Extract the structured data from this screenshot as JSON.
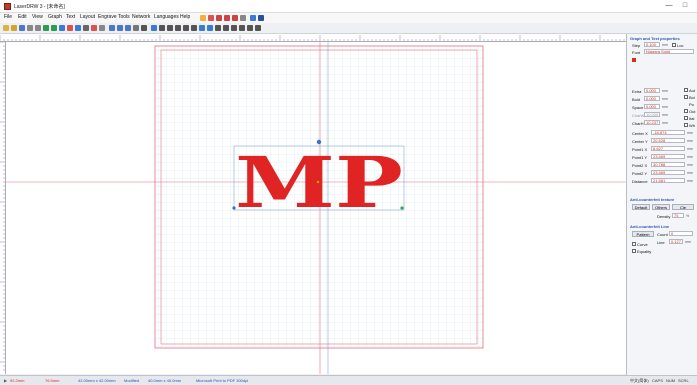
{
  "window": {
    "title": "LaserDRW 3 - [未命名]",
    "min": "—",
    "max": "□"
  },
  "menu": [
    "File",
    "Edit",
    "View",
    "Graph",
    "Text",
    "Layout",
    "Engrave",
    "Tools",
    "Network",
    "Languages",
    "Help"
  ],
  "canvas": {
    "design_text": "MP",
    "text_color": "#e02424"
  },
  "panel": {
    "header": "Graph and Text properties",
    "step_label": "Step",
    "step_value": "0.100",
    "step_unit": "mm",
    "lock_label": "Loc",
    "font_label": "Font",
    "font_value": "Niagara Solid",
    "extra_label": "Extra",
    "extra_value": "0.000",
    "extra_unit": "mm",
    "bold_label": "Bold",
    "bold_value": "0.000",
    "bold_unit": "mm",
    "space_label": "Space",
    "space_value": "0.000",
    "space_unit": "mm",
    "charw_label": "CharW",
    "charw_value": "10.000",
    "charw_unit": "mm",
    "charh_label": "CharH",
    "charh_value": "10.237",
    "charh_unit": "mm",
    "chk1": "Aut",
    "chk2": "Bol",
    "chk3": "Po",
    "chk4": "Out",
    "chk5": "Ital",
    "chk6": "Wh",
    "fields": [
      {
        "label": "Center X",
        "value": "-18.874",
        "unit": "mm"
      },
      {
        "label": "Center Y",
        "value": "20.528",
        "unit": "mm"
      },
      {
        "label": "Point1 X",
        "value": "8.627",
        "unit": "mm"
      },
      {
        "label": "Point1 Y",
        "value": "23.469",
        "unit": "mm"
      },
      {
        "label": "Point2 X",
        "value": "30.788",
        "unit": "mm"
      },
      {
        "label": "Point2 Y",
        "value": "23.469",
        "unit": "mm"
      },
      {
        "label": "Distance",
        "value": "21.581",
        "unit": "mm"
      }
    ],
    "ac_header": "Anti-counterfeit texture",
    "btn_default": "Default",
    "btn_others": "Others",
    "btn_clear": "Cle",
    "density_label": "Density",
    "density_value": "75",
    "density_unit": "%",
    "ac_line_header": "Anti-counterfeit Line",
    "btn_pattern": "Pattern",
    "count_label": "Count",
    "count_value": "0",
    "curve_label": "Curve",
    "equality_label": "Equality",
    "line_label": "Line",
    "line_value": "0.127",
    "line_unit": "mm"
  },
  "status": {
    "s1": "92.2mm",
    "s2": "76.5mm",
    "s3": "42.00mm x 42.00mm",
    "s4": "Modified",
    "s5": "40.0mm x 40.0mm",
    "s6": "Microsoft Print to PDF 300dpi",
    "r1": "中文(简体)",
    "r2": "CAPS",
    "r3": "NUM",
    "r4": "SCRL"
  }
}
